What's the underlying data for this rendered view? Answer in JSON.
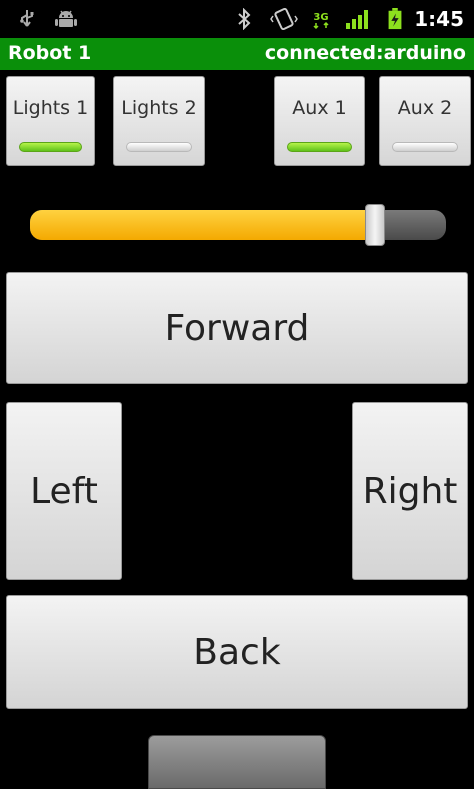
{
  "status_bar": {
    "time": "1:45",
    "network_type": "3G",
    "icons": [
      "usb-icon",
      "android-icon",
      "bluetooth-icon",
      "vibrate-icon",
      "network-3g-icon",
      "signal-icon",
      "battery-charging-icon"
    ]
  },
  "title_bar": {
    "title": "Robot 1",
    "status": "connected:arduino",
    "color": "#0a8f0a"
  },
  "toggles": [
    {
      "label": "Lights 1",
      "on": true
    },
    {
      "label": "Lights 2",
      "on": false
    },
    {
      "label": "Aux 1",
      "on": true
    },
    {
      "label": "Aux 2",
      "on": false
    }
  ],
  "speed_slider": {
    "value": 0.83,
    "fill_color": "#f7b500"
  },
  "controls": {
    "forward": "Forward",
    "left": "Left",
    "right": "Right",
    "back": "Back"
  }
}
